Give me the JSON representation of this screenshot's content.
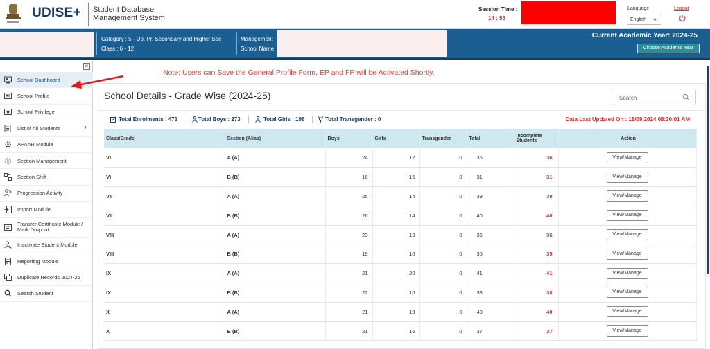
{
  "header": {
    "brand": "UDISE+",
    "system_title_line1": "Student Database",
    "system_title_line2": "Management System",
    "session_label": "Session Time :",
    "session_value": "14 : 56",
    "language_label": "Language",
    "language_value": "English",
    "logout_label": "Logout"
  },
  "band": {
    "category": "Category : 5 - Up. Pr. Secondary and Higher Sec",
    "class": "Class : 6 - 12",
    "management": "Management",
    "school_name": "School Name",
    "academic_year": "Current Academic Year: 2024-25",
    "choose_year": "Choose Academic Year"
  },
  "sidebar": {
    "collapse": "×",
    "items": [
      {
        "label": "School Dashboard",
        "icon": "dashboard-icon"
      },
      {
        "label": "School Profile",
        "icon": "profile-icon"
      },
      {
        "label": "School Privilege",
        "icon": "privilege-icon"
      },
      {
        "label": "List of All Students",
        "icon": "list-icon"
      },
      {
        "label": "APAAR Module",
        "icon": "gear-icon"
      },
      {
        "label": "Section Management",
        "icon": "gear-icon"
      },
      {
        "label": "Section Shift",
        "icon": "shift-icon"
      },
      {
        "label": "Progression Activity",
        "icon": "progression-icon"
      },
      {
        "label": "Import Module",
        "icon": "import-icon"
      },
      {
        "label": "Transfer Certificate Module / Mark Dropout",
        "icon": "transfer-icon"
      },
      {
        "label": "Inactivate Student Module",
        "icon": "inactivate-icon"
      },
      {
        "label": "Reporting Module",
        "icon": "report-icon"
      },
      {
        "label": "Duplicate Records 2024-25",
        "icon": "duplicate-icon"
      },
      {
        "label": "Search Student",
        "icon": "search-icon"
      }
    ]
  },
  "note": "Note: Users can Save the General Profile Form, EP and FP will be Activated Shortly.",
  "main": {
    "title": "School Details - Grade Wise (2024-25)",
    "search_placeholder": "Search",
    "stats": {
      "enrolments": "Total Enrolments : 471",
      "boys": "Total Boys : 273",
      "girls": "Total Girls : 198",
      "transgender": "Total Transgender : 0"
    },
    "data_updated": "Data Last Updated On : 18/09/2024 08:30:01 AM",
    "columns": [
      "Class/Grade",
      "Section (Alias)",
      "Boys",
      "Girls",
      "Transgender",
      "Total",
      "Incomplete Students",
      "Action"
    ],
    "action_label": "View/Manage",
    "rows": [
      {
        "grade": "VI",
        "section": "A (A)",
        "boys": "24",
        "girls": "12",
        "trans": "0",
        "total": "36",
        "incomplete": "36"
      },
      {
        "grade": "VI",
        "section": "B (B)",
        "boys": "16",
        "girls": "15",
        "trans": "0",
        "total": "31",
        "incomplete": "31"
      },
      {
        "grade": "VII",
        "section": "A (A)",
        "boys": "25",
        "girls": "14",
        "trans": "0",
        "total": "39",
        "incomplete": "39"
      },
      {
        "grade": "VII",
        "section": "B (B)",
        "boys": "26",
        "girls": "14",
        "trans": "0",
        "total": "40",
        "incomplete": "40"
      },
      {
        "grade": "VIII",
        "section": "A (A)",
        "boys": "23",
        "girls": "13",
        "trans": "0",
        "total": "36",
        "incomplete": "36"
      },
      {
        "grade": "VIII",
        "section": "B (B)",
        "boys": "19",
        "girls": "16",
        "trans": "0",
        "total": "35",
        "incomplete": "35"
      },
      {
        "grade": "IX",
        "section": "A (A)",
        "boys": "21",
        "girls": "20",
        "trans": "0",
        "total": "41",
        "incomplete": "41"
      },
      {
        "grade": "IX",
        "section": "B (B)",
        "boys": "22",
        "girls": "16",
        "trans": "0",
        "total": "38",
        "incomplete": "38"
      },
      {
        "grade": "X",
        "section": "A (A)",
        "boys": "21",
        "girls": "19",
        "trans": "0",
        "total": "40",
        "incomplete": "40"
      },
      {
        "grade": "X",
        "section": "B (B)",
        "boys": "21",
        "girls": "16",
        "trans": "0",
        "total": "37",
        "incomplete": "37"
      }
    ]
  }
}
